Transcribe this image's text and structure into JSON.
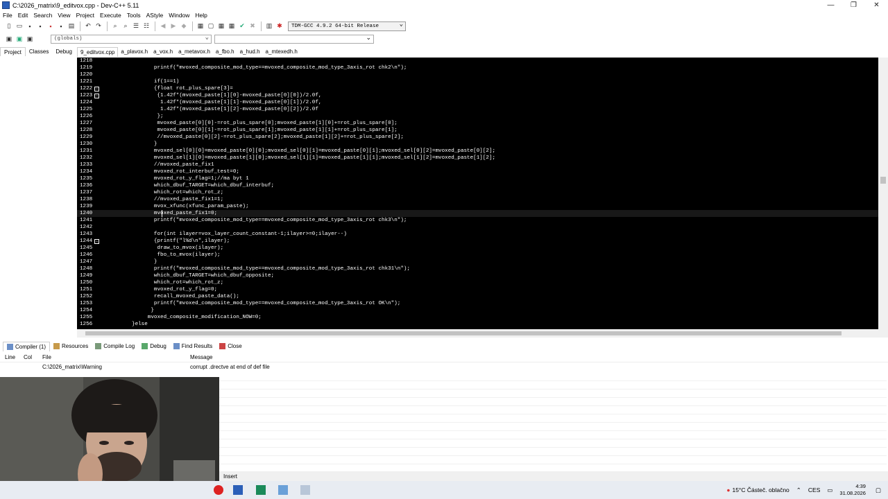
{
  "window": {
    "title": "C:\\2026_matrix\\9_editvox.cpp - Dev-C++ 5.11",
    "minimize": "—",
    "maximize": "❐",
    "close": "✕"
  },
  "menu": [
    "File",
    "Edit",
    "Search",
    "View",
    "Project",
    "Execute",
    "Tools",
    "AStyle",
    "Window",
    "Help"
  ],
  "compiler": {
    "selected": "TDM-GCC 4.9.2 64-bit Release"
  },
  "scope": {
    "selected": "(globals)"
  },
  "left_tabs": [
    "Project",
    "Classes",
    "Debug"
  ],
  "file_tabs": [
    "9_editvox.cpp",
    "a_plavox.h",
    "a_vox.h",
    "a_metavox.h",
    "a_fbo.h",
    "a_hud.h",
    "a_mtexedh.h"
  ],
  "active_file_tab": 0,
  "editor": {
    "lines": [
      {
        "n": "1218",
        "t": ""
      },
      {
        "n": "1219",
        "t": "                printf(\"mvoxed_composite_mod_type==mvoxed_composite_mod_type_3axis_rot chk2\\n\");"
      },
      {
        "n": "1220",
        "t": ""
      },
      {
        "n": "1221",
        "t": "                if(1==1)"
      },
      {
        "n": "1222",
        "t": "                {float rot_plus_spare[3]=",
        "fold": "−"
      },
      {
        "n": "1223",
        "t": "                 {1.42f*(mvoxed_paste[1][0]-mvoxed_paste[0][0])/2.0f,",
        "fold": "−"
      },
      {
        "n": "1224",
        "t": "                  1.42f*(mvoxed_paste[1][1]-mvoxed_paste[0][1])/2.0f,"
      },
      {
        "n": "1225",
        "t": "                  1.42f*(mvoxed_paste[1][2]-mvoxed_paste[0][2])/2.0f"
      },
      {
        "n": "1226",
        "t": "                 };"
      },
      {
        "n": "1227",
        "t": "                 mvoxed_paste[0][0]-=rot_plus_spare[0];mvoxed_paste[1][0]+=rot_plus_spare[0];"
      },
      {
        "n": "1228",
        "t": "                 mvoxed_paste[0][1]-=rot_plus_spare[1];mvoxed_paste[1][1]+=rot_plus_spare[1];"
      },
      {
        "n": "1229",
        "t": "                 //mvoxed_paste[0][2]-=rot_plus_spare[2];mvoxed_paste[1][2]+=rot_plus_spare[2];"
      },
      {
        "n": "1230",
        "t": "                }"
      },
      {
        "n": "1231",
        "t": "                mvoxed_sel[0][0]=mvoxed_paste[0][0];mvoxed_sel[0][1]=mvoxed_paste[0][1];mvoxed_sel[0][2]=mvoxed_paste[0][2];"
      },
      {
        "n": "1232",
        "t": "                mvoxed_sel[1][0]=mvoxed_paste[1][0];mvoxed_sel[1][1]=mvoxed_paste[1][1];mvoxed_sel[1][2]=mvoxed_paste[1][2];"
      },
      {
        "n": "1233",
        "t": "                //mvoxed_paste_fix1"
      },
      {
        "n": "1234",
        "t": "                mvoxed_rot_interbuf_test=0;"
      },
      {
        "n": "1235",
        "t": "                mvoxed_rot_y_flag=1;//ma byt 1"
      },
      {
        "n": "1236",
        "t": "                which_dbuf_TARGET=which_dbuf_interbuf;"
      },
      {
        "n": "1237",
        "t": "                which_rot=which_rot_z;"
      },
      {
        "n": "1238",
        "t": "                //mvoxed_paste_fix1=1;"
      },
      {
        "n": "1239",
        "t": "                mvox_xfunc(xfunc_param_paste);"
      },
      {
        "n": "1240",
        "t": "                mvoxed_paste_fix1=0;",
        "highlight": true
      },
      {
        "n": "1241",
        "t": "                printf(\"mvoxed_composite_mod_type==mvoxed_composite_mod_type_3axis_rot chk3\\n\");"
      },
      {
        "n": "1242",
        "t": ""
      },
      {
        "n": "1243",
        "t": "                for(int ilayer=vox_layer_count_constant-1;ilayer>=0;ilayer--)"
      },
      {
        "n": "1244",
        "t": "                {printf(\"l%d\\n\",ilayer);",
        "fold": "−"
      },
      {
        "n": "1245",
        "t": "                 draw_to_mvox(ilayer);"
      },
      {
        "n": "1246",
        "t": "                 fbo_to_mvox(ilayer);"
      },
      {
        "n": "1247",
        "t": "                }"
      },
      {
        "n": "1248",
        "t": "                printf(\"mvoxed_composite_mod_type==mvoxed_composite_mod_type_3axis_rot chk31\\n\");"
      },
      {
        "n": "1249",
        "t": "                which_dbuf_TARGET=which_dbuf_opposite;"
      },
      {
        "n": "1250",
        "t": "                which_rot=which_rot_z;"
      },
      {
        "n": "1251",
        "t": "                mvoxed_rot_y_flag=0;"
      },
      {
        "n": "1252",
        "t": "                recall_mvoxed_paste_data();"
      },
      {
        "n": "1253",
        "t": "                printf(\"mvoxed_composite_mod_type==mvoxed_composite_mod_type_3axis_rot OK\\n\");"
      },
      {
        "n": "1254",
        "t": "               }"
      },
      {
        "n": "1255",
        "t": "              mvoxed_composite_modification_NOW=0;"
      },
      {
        "n": "1256",
        "t": "         }else"
      }
    ]
  },
  "bottom_tabs": [
    "Compiler (1)",
    "Resources",
    "Compile Log",
    "Debug",
    "Find Results",
    "Close"
  ],
  "messages": {
    "headers": {
      "line": "Line",
      "col": "Col",
      "file": "File",
      "message": "Message"
    },
    "rows": [
      {
        "line": "",
        "col": "",
        "file": "C:\\2026_matrix\\Warning",
        "message": "corrupt .drectve at end of def file"
      }
    ]
  },
  "status": {
    "mode": "Insert"
  },
  "taskbar": {
    "weather": "15°C  Částeč. oblačno",
    "lang": "CES",
    "time": "4:39",
    "date": "31.08.2026"
  }
}
